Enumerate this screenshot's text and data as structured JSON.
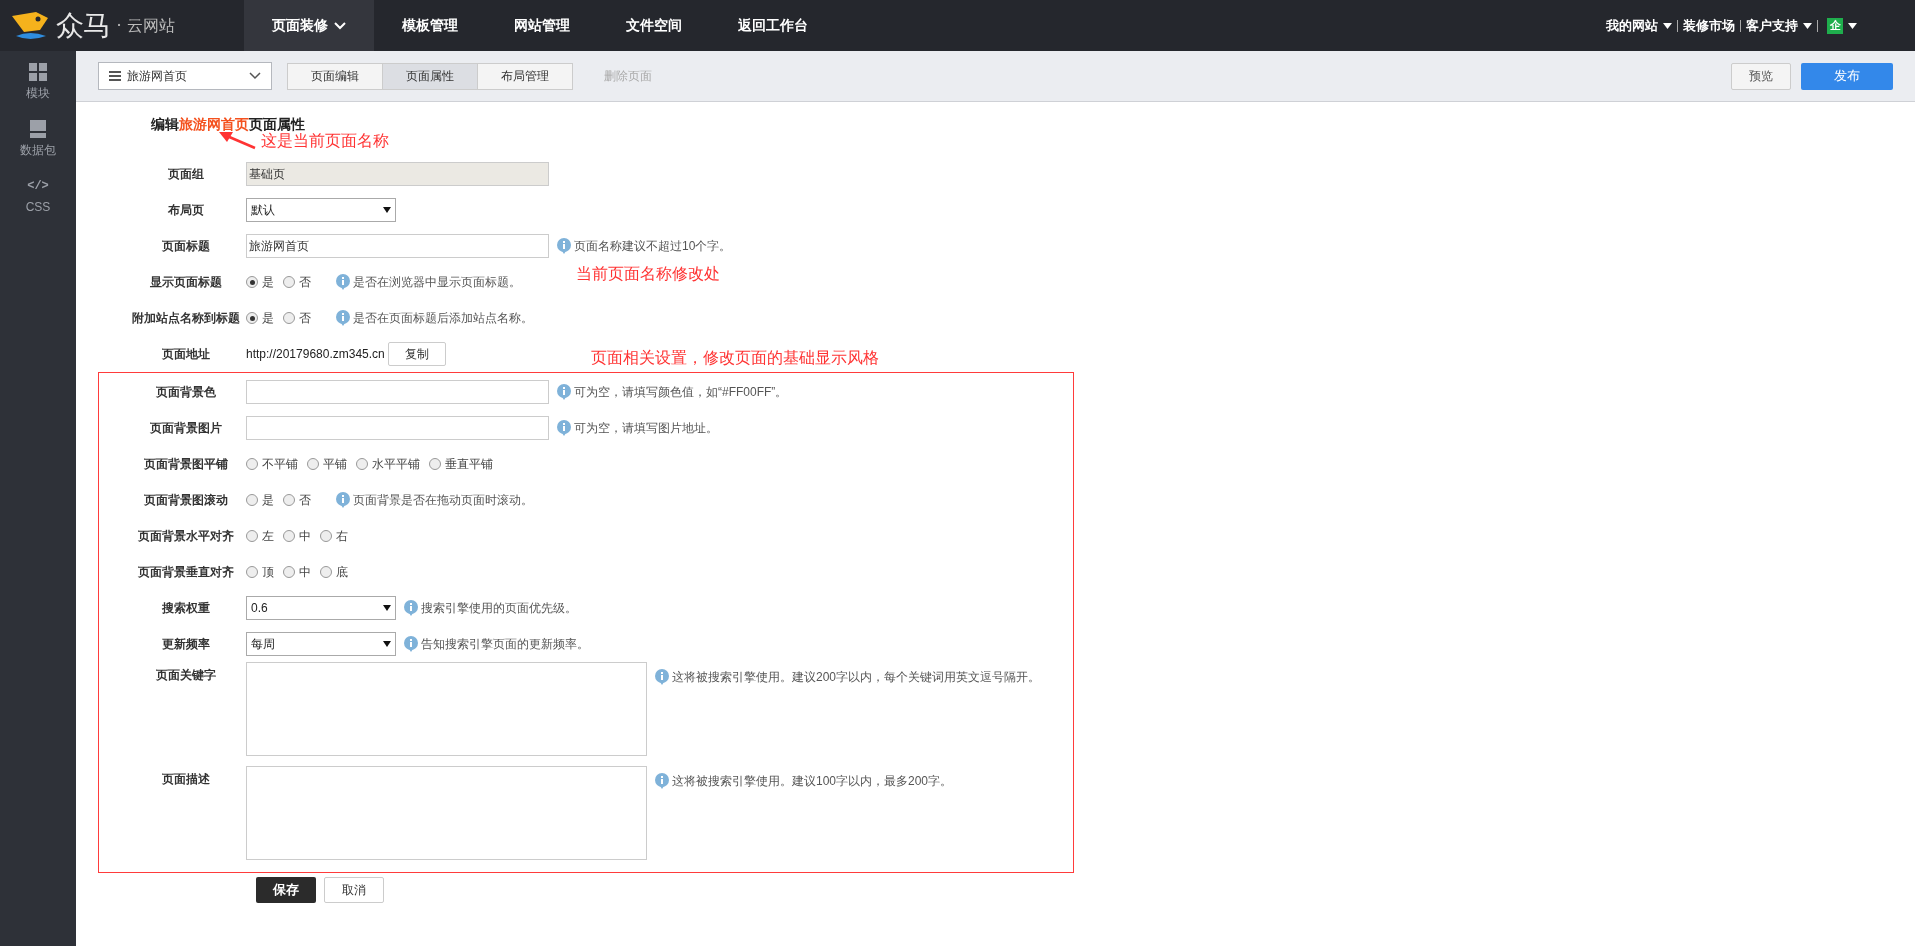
{
  "logo": {
    "brand": "众马",
    "sub": "· 云网站"
  },
  "nav": [
    {
      "label": "页面装修",
      "selected": true,
      "dropdown": true
    },
    {
      "label": "模板管理",
      "selected": false
    },
    {
      "label": "网站管理",
      "selected": false
    },
    {
      "label": "文件空间",
      "selected": false
    },
    {
      "label": "返回工作台",
      "selected": false
    }
  ],
  "top_links": [
    {
      "label": "我的网站",
      "dropdown": true
    },
    {
      "label": "装修市场"
    },
    {
      "label": "客户支持",
      "dropdown": true
    },
    {
      "label": "企",
      "kind": "badge",
      "dropdown": true
    }
  ],
  "sidebar": [
    {
      "label": "模块",
      "kind": "grid"
    },
    {
      "label": "数据包",
      "kind": "box"
    },
    {
      "label": "CSS",
      "kind": "code",
      "glyph": "</>"
    }
  ],
  "toolbar": {
    "page_select": "旅游网首页",
    "tabs": [
      {
        "label": "页面编辑",
        "selected": false
      },
      {
        "label": "页面属性",
        "selected": true
      },
      {
        "label": "布局管理",
        "selected": false
      }
    ],
    "delete": "删除页面",
    "preview": "预览",
    "publish": "发布"
  },
  "form": {
    "title_prefix": "编辑",
    "page_name": "旅游网首页",
    "title_suffix": "页面属性",
    "rows": [
      {
        "kind": "readonly",
        "label": "页面组",
        "value": "基础页"
      },
      {
        "kind": "select",
        "label": "布局页",
        "value": "默认"
      },
      {
        "kind": "text",
        "label": "页面标题",
        "value": "旅游网首页",
        "hint": "页面名称建议不超过10个字。"
      },
      {
        "kind": "radio",
        "label": "显示页面标题",
        "options": [
          {
            "label": "是",
            "selected": true
          },
          {
            "label": "否",
            "selected": false
          }
        ],
        "hint": "是否在浏览器中显示页面标题。"
      },
      {
        "kind": "radio",
        "label": "附加站点名称到标题",
        "options": [
          {
            "label": "是",
            "selected": true
          },
          {
            "label": "否",
            "selected": false
          }
        ],
        "hint": "是否在页面标题后添加站点名称。"
      },
      {
        "kind": "url",
        "label": "页面地址",
        "value": "http://20179680.zm345.cn",
        "button": "复制"
      }
    ],
    "box_rows": [
      {
        "kind": "text",
        "label": "页面背景色",
        "hint": "可为空，请填写颜色值，如“#FF00FF”。"
      },
      {
        "kind": "text",
        "label": "页面背景图片",
        "hint": "可为空，请填写图片地址。"
      },
      {
        "kind": "radio",
        "label": "页面背景图平铺",
        "options": [
          {
            "label": "不平铺",
            "selected": false
          },
          {
            "label": "平铺",
            "selected": false
          },
          {
            "label": "水平平铺",
            "selected": false
          },
          {
            "label": "垂直平铺",
            "selected": false
          }
        ]
      },
      {
        "kind": "radio",
        "label": "页面背景图滚动",
        "options": [
          {
            "label": "是",
            "selected": false
          },
          {
            "label": "否",
            "selected": false
          }
        ],
        "hint": "页面背景是否在拖动页面时滚动。"
      },
      {
        "kind": "radio",
        "label": "页面背景水平对齐",
        "options": [
          {
            "label": "左",
            "selected": false
          },
          {
            "label": "中",
            "selected": false
          },
          {
            "label": "右",
            "selected": false
          }
        ]
      },
      {
        "kind": "radio",
        "label": "页面背景垂直对齐",
        "options": [
          {
            "label": "顶",
            "selected": false
          },
          {
            "label": "中",
            "selected": false
          },
          {
            "label": "底",
            "selected": false
          }
        ]
      },
      {
        "kind": "select",
        "label": "搜索权重",
        "value": "0.6",
        "hint": "搜索引擎使用的页面优先级。"
      },
      {
        "kind": "select",
        "label": "更新频率",
        "value": "每周",
        "hint": "告知搜索引擎页面的更新频率。"
      },
      {
        "kind": "textarea",
        "label": "页面关键字",
        "hint": "这将被搜索引擎使用。建议200字以内，每个关键词用英文逗号隔开。"
      },
      {
        "kind": "textarea",
        "label": "页面描述",
        "hint": "这将被搜索引擎使用。建议100字以内，最多200字。"
      }
    ],
    "save": "保存",
    "cancel": "取消"
  },
  "annotations": [
    {
      "text": "这是当前页面名称",
      "arrow": true
    },
    {
      "text": "当前页面名称修改处"
    },
    {
      "text": "页面相关设置，修改页面的基础显示风格"
    }
  ]
}
